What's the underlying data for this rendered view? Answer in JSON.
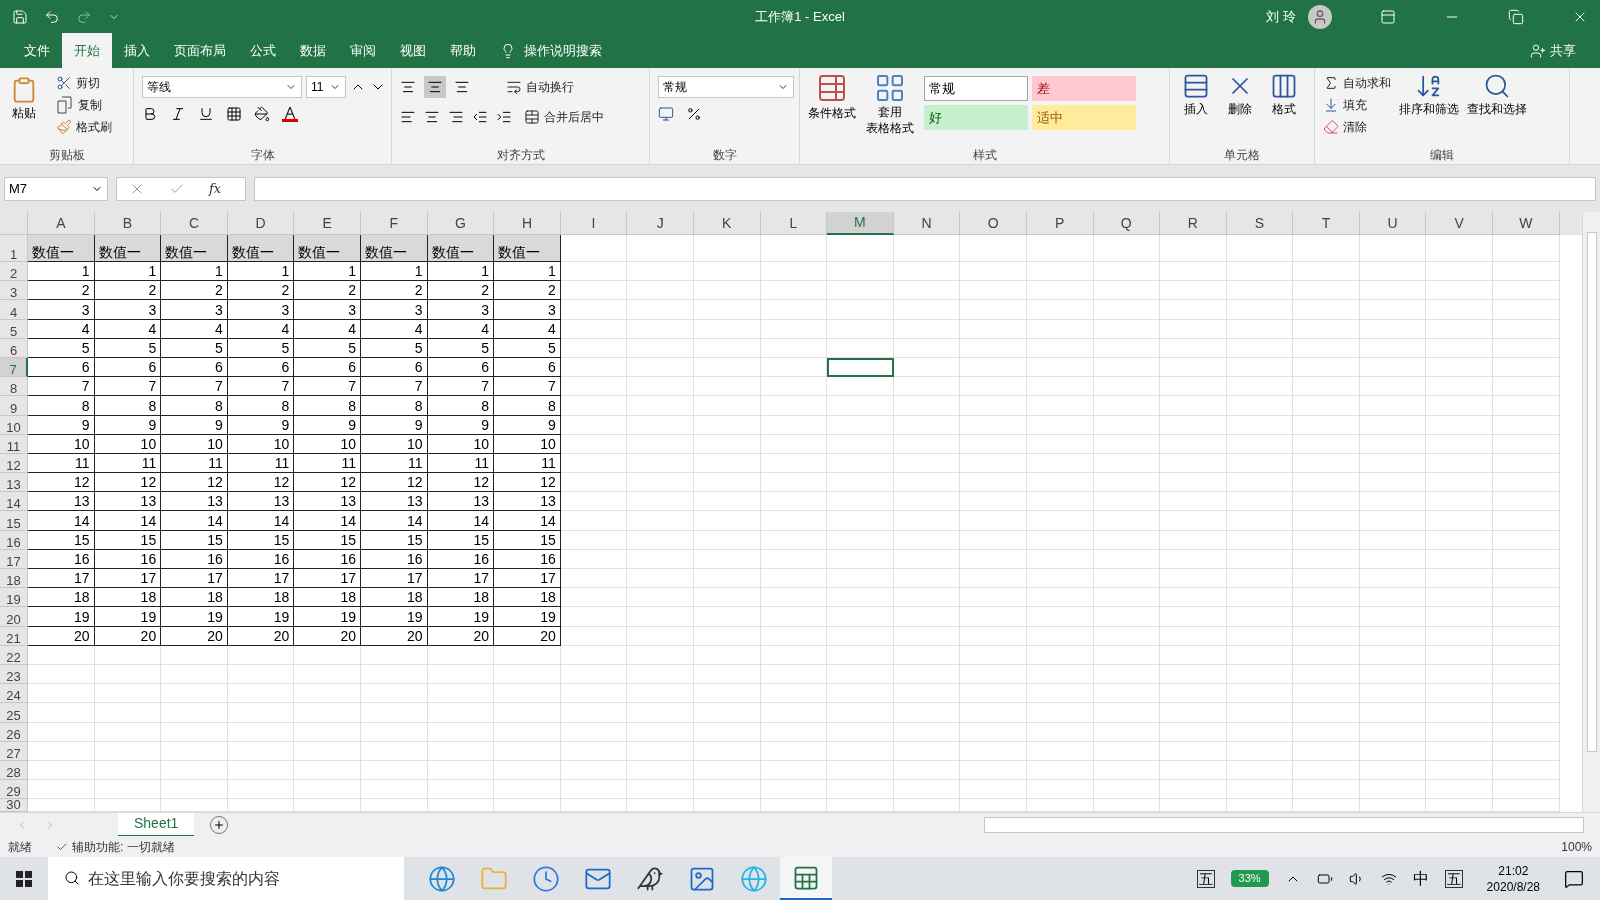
{
  "window": {
    "title": "工作簿1 - Excel",
    "user": "刘 玲"
  },
  "ribbon_tabs": [
    {
      "label": "文件",
      "selected": false
    },
    {
      "label": "开始",
      "selected": true
    },
    {
      "label": "插入",
      "selected": false
    },
    {
      "label": "页面布局",
      "selected": false
    },
    {
      "label": "公式",
      "selected": false
    },
    {
      "label": "数据",
      "selected": false
    },
    {
      "label": "审阅",
      "selected": false
    },
    {
      "label": "视图",
      "selected": false
    },
    {
      "label": "帮助",
      "selected": false
    }
  ],
  "tell_me": "操作说明搜索",
  "share": "共享",
  "clipboard": {
    "paste": "粘贴",
    "cut": "剪切",
    "copy": "复制",
    "format_painter": "格式刷",
    "label": "剪贴板"
  },
  "font": {
    "name": "等线",
    "size": "11",
    "label": "字体"
  },
  "alignment": {
    "wrap": "自动换行",
    "merge": "合并后居中",
    "label": "对齐方式"
  },
  "number": {
    "format": "常规",
    "label": "数字"
  },
  "styles": {
    "conditional": "条件格式",
    "table_format": [
      "套用",
      "表格格式"
    ],
    "label": "样式",
    "cell_styles": [
      {
        "label": "常规",
        "kind": "normal",
        "color": "#ffffff"
      },
      {
        "label": "差",
        "kind": "bad",
        "color": "#ffc7ce"
      },
      {
        "label": "好",
        "kind": "good",
        "color": "#c6efce"
      },
      {
        "label": "适中",
        "kind": "neutral",
        "color": "#ffeb9c"
      }
    ]
  },
  "cells": {
    "insert": "插入",
    "delete": "删除",
    "format": "格式",
    "label": "单元格"
  },
  "editing": {
    "autosum": "自动求和",
    "fill": "填充",
    "clear": "清除",
    "sort": "排序和筛选",
    "find": "查找和选择",
    "label": "编辑"
  },
  "formula_bar": {
    "name_box": "M7",
    "function_button": "fx"
  },
  "sheet": {
    "columns": [
      {
        "label": "A",
        "selected": false
      },
      {
        "label": "B",
        "selected": false
      },
      {
        "label": "C",
        "selected": false
      },
      {
        "label": "D",
        "selected": false
      },
      {
        "label": "E",
        "selected": false
      },
      {
        "label": "F",
        "selected": false
      },
      {
        "label": "G",
        "selected": false
      },
      {
        "label": "H",
        "selected": false
      },
      {
        "label": "I",
        "selected": false
      },
      {
        "label": "J",
        "selected": false
      },
      {
        "label": "K",
        "selected": false
      },
      {
        "label": "L",
        "selected": false
      },
      {
        "label": "M",
        "selected": true
      },
      {
        "label": "N",
        "selected": false
      },
      {
        "label": "O",
        "selected": false
      },
      {
        "label": "P",
        "selected": false
      },
      {
        "label": "Q",
        "selected": false
      },
      {
        "label": "R",
        "selected": false
      },
      {
        "label": "S",
        "selected": false
      },
      {
        "label": "T",
        "selected": false
      },
      {
        "label": "U",
        "selected": false
      },
      {
        "label": "V",
        "selected": false
      },
      {
        "label": "W",
        "selected": false
      }
    ],
    "rows": [
      {
        "label": "1",
        "selected": false,
        "cells": [
          "数值一",
          "数值一",
          "数值一",
          "数值一",
          "数值一",
          "数值一",
          "数值一",
          "数值一"
        ]
      },
      {
        "label": "2",
        "selected": false,
        "cells": [
          "1",
          "1",
          "1",
          "1",
          "1",
          "1",
          "1",
          "1"
        ]
      },
      {
        "label": "3",
        "selected": false,
        "cells": [
          "2",
          "2",
          "2",
          "2",
          "2",
          "2",
          "2",
          "2"
        ]
      },
      {
        "label": "4",
        "selected": false,
        "cells": [
          "3",
          "3",
          "3",
          "3",
          "3",
          "3",
          "3",
          "3"
        ]
      },
      {
        "label": "5",
        "selected": false,
        "cells": [
          "4",
          "4",
          "4",
          "4",
          "4",
          "4",
          "4",
          "4"
        ]
      },
      {
        "label": "6",
        "selected": false,
        "cells": [
          "5",
          "5",
          "5",
          "5",
          "5",
          "5",
          "5",
          "5"
        ]
      },
      {
        "label": "7",
        "selected": true,
        "cells": [
          "6",
          "6",
          "6",
          "6",
          "6",
          "6",
          "6",
          "6"
        ]
      },
      {
        "label": "8",
        "selected": false,
        "cells": [
          "7",
          "7",
          "7",
          "7",
          "7",
          "7",
          "7",
          "7"
        ]
      },
      {
        "label": "9",
        "selected": false,
        "cells": [
          "8",
          "8",
          "8",
          "8",
          "8",
          "8",
          "8",
          "8"
        ]
      },
      {
        "label": "10",
        "selected": false,
        "cells": [
          "9",
          "9",
          "9",
          "9",
          "9",
          "9",
          "9",
          "9"
        ]
      },
      {
        "label": "11",
        "selected": false,
        "cells": [
          "10",
          "10",
          "10",
          "10",
          "10",
          "10",
          "10",
          "10"
        ]
      },
      {
        "label": "12",
        "selected": false,
        "cells": [
          "11",
          "11",
          "11",
          "11",
          "11",
          "11",
          "11",
          "11"
        ]
      },
      {
        "label": "13",
        "selected": false,
        "cells": [
          "12",
          "12",
          "12",
          "12",
          "12",
          "12",
          "12",
          "12"
        ]
      },
      {
        "label": "14",
        "selected": false,
        "cells": [
          "13",
          "13",
          "13",
          "13",
          "13",
          "13",
          "13",
          "13"
        ]
      },
      {
        "label": "15",
        "selected": false,
        "cells": [
          "14",
          "14",
          "14",
          "14",
          "14",
          "14",
          "14",
          "14"
        ]
      },
      {
        "label": "16",
        "selected": false,
        "cells": [
          "15",
          "15",
          "15",
          "15",
          "15",
          "15",
          "15",
          "15"
        ]
      },
      {
        "label": "17",
        "selected": false,
        "cells": [
          "16",
          "16",
          "16",
          "16",
          "16",
          "16",
          "16",
          "16"
        ]
      },
      {
        "label": "18",
        "selected": false,
        "cells": [
          "17",
          "17",
          "17",
          "17",
          "17",
          "17",
          "17",
          "17"
        ]
      },
      {
        "label": "19",
        "selected": false,
        "cells": [
          "18",
          "18",
          "18",
          "18",
          "18",
          "18",
          "18",
          "18"
        ]
      },
      {
        "label": "20",
        "selected": false,
        "cells": [
          "19",
          "19",
          "19",
          "19",
          "19",
          "19",
          "19",
          "19"
        ]
      },
      {
        "label": "21",
        "selected": false,
        "cells": [
          "20",
          "20",
          "20",
          "20",
          "20",
          "20",
          "20",
          "20"
        ]
      },
      {
        "label": "22",
        "selected": false
      },
      {
        "label": "23",
        "selected": false
      },
      {
        "label": "24",
        "selected": false
      },
      {
        "label": "25",
        "selected": false
      },
      {
        "label": "26",
        "selected": false
      },
      {
        "label": "27",
        "selected": false
      },
      {
        "label": "28",
        "selected": false
      },
      {
        "label": "29",
        "selected": false
      },
      {
        "label": "30",
        "selected": false
      }
    ]
  },
  "sheet_tabs": [
    {
      "label": "Sheet1",
      "selected": true
    }
  ],
  "status_bar": {
    "status": "就绪",
    "accessibility": "辅助功能: 一切就绪",
    "zoom": "100%"
  },
  "taskbar": {
    "search_placeholder": "在这里输入你要搜索的内容",
    "apps": [
      {
        "kind": "edge",
        "active": false
      },
      {
        "kind": "folder",
        "active": false
      },
      {
        "kind": "clock",
        "active": false
      },
      {
        "kind": "mail",
        "active": false
      },
      {
        "kind": "bird",
        "active": false
      },
      {
        "kind": "photos",
        "active": false
      },
      {
        "kind": "browser",
        "active": false
      },
      {
        "kind": "excel",
        "active": true
      }
    ],
    "ime": "五",
    "battery": "33%",
    "language": "中",
    "ime_mode": "五",
    "time": "21:02",
    "date": "2020/8/28"
  }
}
